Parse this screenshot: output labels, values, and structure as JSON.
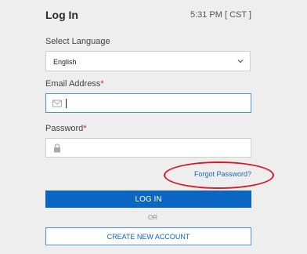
{
  "header": {
    "title": "Log In",
    "time": "5:31 PM [ CST ]"
  },
  "language": {
    "label": "Select Language",
    "selected": "English",
    "icon": "chevron-down-icon"
  },
  "email": {
    "label": "Email Address",
    "required_mark": "*",
    "value": "",
    "icon": "envelope-icon"
  },
  "password": {
    "label": "Password",
    "required_mark": "*",
    "value": "",
    "icon": "lock-icon"
  },
  "links": {
    "forgot_password": "Forgot Password?"
  },
  "buttons": {
    "login": "LOG IN",
    "separator": "OR",
    "create_account": "CREATE NEW ACCOUNT"
  },
  "colors": {
    "primary": "#0b65c2",
    "link": "#1a66b8",
    "required": "#c0282d",
    "highlight_oval": "#d8182a",
    "background": "#eeeeee"
  }
}
